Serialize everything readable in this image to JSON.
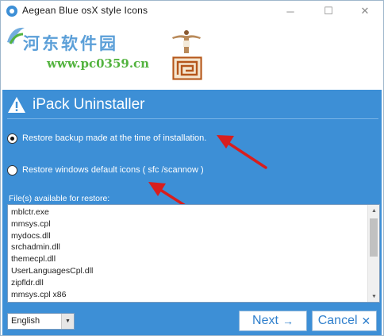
{
  "window": {
    "title": "Aegean Blue osX style Icons",
    "icon": "app-icon",
    "controls": {
      "minimize": "─",
      "maximize": "☐",
      "close": "✕"
    }
  },
  "banner": {
    "watermark_title": "河东软件园",
    "watermark_url": "www.pc0359.cn",
    "images": [
      "statue-figure",
      "greek-key-tile"
    ]
  },
  "panel": {
    "title": "iPack Uninstaller",
    "title_icon": "warning-icon",
    "options": [
      {
        "label": "Restore backup made at the time of installation.",
        "checked": true
      },
      {
        "label": "Restore windows default icons ( sfc /scannow )",
        "checked": false
      }
    ],
    "files_label": "File(s) available for restore:",
    "files": [
      "mblctr.exe",
      "mmsys.cpl",
      "mydocs.dll",
      "srchadmin.dll",
      "themecpl.dll",
      "UserLanguagesCpl.dll",
      "zipfldr.dll",
      "mmsys.cpl x86"
    ]
  },
  "footer": {
    "language": "English",
    "next_label": "Next",
    "next_glyph": "→",
    "cancel_label": "Cancel",
    "cancel_glyph": "✕"
  },
  "colors": {
    "panel_bg": "#3d8fd6",
    "button_text": "#2f7fcc",
    "arrow": "#d81e1e",
    "watermark_blue": "#5b9fd8",
    "watermark_green": "#53b33f"
  }
}
